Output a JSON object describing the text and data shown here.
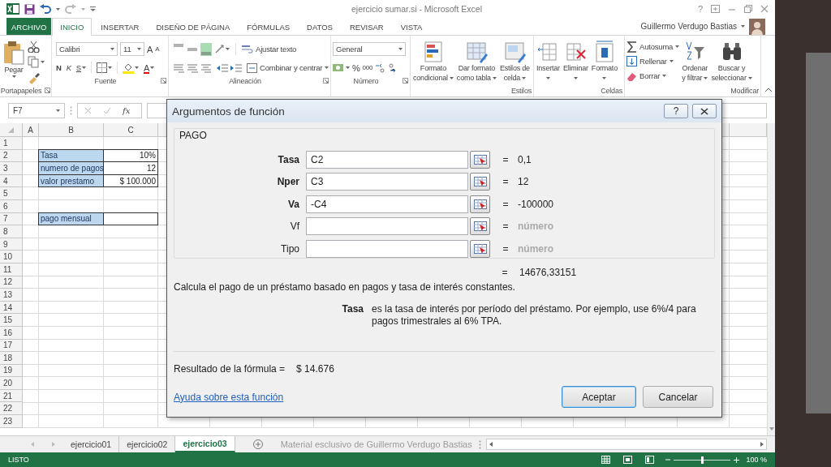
{
  "title_bar": {
    "title": "ejercicio sumar.si - Microsoft Excel",
    "help": "?"
  },
  "ribbon_tabs": [
    {
      "label": "ARCHIVO",
      "kind": "file",
      "selected": false
    },
    {
      "label": "INICIO",
      "kind": "tab",
      "selected": true
    },
    {
      "label": "INSERTAR",
      "kind": "tab",
      "selected": false
    },
    {
      "label": "DISEÑO DE PÁGINA",
      "kind": "tab",
      "selected": false
    },
    {
      "label": "FÓRMULAS",
      "kind": "tab",
      "selected": false
    },
    {
      "label": "DATOS",
      "kind": "tab",
      "selected": false
    },
    {
      "label": "REVISAR",
      "kind": "tab",
      "selected": false
    },
    {
      "label": "VISTA",
      "kind": "tab",
      "selected": false
    }
  ],
  "user": {
    "name": "Guillermo Verdugo Bastias"
  },
  "ribbon": {
    "clipboard": {
      "label": "Portapapeles",
      "paste": "Pegar"
    },
    "font": {
      "label": "Fuente",
      "font_name": "Calibri",
      "font_size": "11",
      "grow": "A",
      "shrink": "A",
      "bold": "N",
      "italic": "K",
      "underline": "S",
      "font_color": "A"
    },
    "alignment": {
      "label": "Alineación",
      "vertical_align": [
        {
          "selected": false
        },
        {
          "selected": false
        },
        {
          "selected": true
        }
      ],
      "wrap": "Ajustar texto",
      "merge": "Combinar y centrar"
    },
    "number": {
      "label": "Número",
      "format": "General",
      "percent": "%",
      "thousands": "000"
    },
    "styles": {
      "label": "Estilos",
      "buttons": [
        {
          "lines": [
            "Formato",
            "condicional"
          ]
        },
        {
          "lines": [
            "Dar formato",
            "como tabla"
          ]
        },
        {
          "lines": [
            "Estilos de",
            "celda"
          ]
        }
      ]
    },
    "cells": {
      "label": "Celdas",
      "buttons": [
        {
          "lines": [
            "Insertar"
          ]
        },
        {
          "lines": [
            "Eliminar"
          ]
        },
        {
          "lines": [
            "Formato"
          ]
        }
      ]
    },
    "editing": {
      "label": "Modificar",
      "small": [
        {
          "label": "Autosuma"
        },
        {
          "label": "Rellenar"
        },
        {
          "label": "Borrar"
        }
      ],
      "large": [
        {
          "lines": [
            "Ordenar",
            "y filtrar"
          ]
        },
        {
          "lines": [
            "Buscar y",
            "seleccionar"
          ]
        }
      ]
    }
  },
  "formula_bar": {
    "name_box": "F7",
    "function_label": "fx"
  },
  "sheet": {
    "columns": [
      "A",
      "B",
      "C"
    ],
    "rows": [
      {
        "header": "1"
      },
      {
        "header": "2",
        "b": "Tasa",
        "c": "10%",
        "boxed": true
      },
      {
        "header": "3",
        "b": "numero de pagos",
        "c": "12",
        "boxed": true
      },
      {
        "header": "4",
        "b": "valor prestamo",
        "c": "$ 100.000",
        "boxed": true
      },
      {
        "header": "5"
      },
      {
        "header": "6"
      },
      {
        "header": "7",
        "b": "pago mensual",
        "boxed": true
      },
      {
        "header": "8"
      },
      {
        "header": "9"
      },
      {
        "header": "10"
      },
      {
        "header": "11"
      },
      {
        "header": "12"
      },
      {
        "header": "13"
      },
      {
        "header": "14"
      },
      {
        "header": "15"
      },
      {
        "header": "16"
      },
      {
        "header": "17"
      },
      {
        "header": "18"
      },
      {
        "header": "19"
      },
      {
        "header": "20"
      },
      {
        "header": "21"
      },
      {
        "header": "22"
      },
      {
        "header": "23"
      }
    ]
  },
  "dialog": {
    "title": "Argumentos de función",
    "help": "?",
    "function": "PAGO",
    "args": [
      {
        "name": "Tasa",
        "value": "C2",
        "result": "0,1",
        "required": true,
        "evaluated": true
      },
      {
        "name": "Nper",
        "value": "C3",
        "result": "12",
        "required": true,
        "evaluated": true
      },
      {
        "name": "Va",
        "value": "-C4",
        "result": "-100000",
        "required": true,
        "evaluated": true
      },
      {
        "name": "Vf",
        "result": "número",
        "required": false,
        "evaluated": false
      },
      {
        "name": "Tipo",
        "result": "número",
        "required": false,
        "evaluated": false
      }
    ],
    "equals": "=",
    "result": "14676,33151",
    "description": "Calcula el pago de un préstamo basado en pagos y tasa de interés constantes.",
    "arg_help": {
      "name": "Tasa",
      "text": "es la tasa de interés por período del préstamo. Por ejemplo, use 6%/4 para pagos trimestrales al 6% TPA."
    },
    "formula_result": {
      "label": "Resultado de la fórmula =",
      "value": "$ 14.676"
    },
    "help_link": "Ayuda sobre esta función",
    "buttons": [
      {
        "label": "Aceptar",
        "default": true
      },
      {
        "label": "Cancelar",
        "default": false
      }
    ]
  },
  "sheet_tabs": [
    {
      "label": "ejercicio01",
      "selected": false
    },
    {
      "label": "ejercicio02",
      "selected": false
    },
    {
      "label": "ejercicio03",
      "selected": true
    }
  ],
  "tab_bar_note": "Material esclusivo de Guillermo Verdugo Bastias",
  "status_bar": {
    "status": "LISTO",
    "zoom": {
      "label": "100 %",
      "level": 0.5
    }
  }
}
